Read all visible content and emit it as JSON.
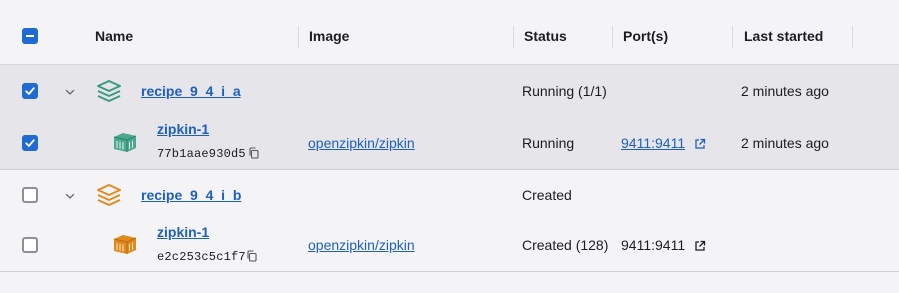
{
  "header": {
    "columns": {
      "name": "Name",
      "image": "Image",
      "status": "Status",
      "ports": "Port(s)",
      "last_started": "Last started"
    }
  },
  "groups": [
    {
      "name": "recipe_9_4_i_a",
      "status": "Running (1/1)",
      "last_started": "2 minutes ago",
      "selected": true,
      "icon": "stack-icon",
      "icon_color": "#3d9a82",
      "container": {
        "name": "zipkin-1",
        "id": "77b1aae930d5",
        "image": "openzipkin/zipkin",
        "status": "Running",
        "ports": "9411:9411",
        "last_started": "2 minutes ago",
        "selected": true,
        "icon": "container-icon",
        "icon_color": "#4aa88f"
      }
    },
    {
      "name": "recipe_9_4_i_b",
      "status": "Created",
      "last_started": "",
      "selected": false,
      "icon": "stack-icon",
      "icon_color": "#e08a1e",
      "container": {
        "name": "zipkin-1",
        "id": "e2c253c5c1f7",
        "image": "openzipkin/zipkin",
        "status": "Created (128)",
        "ports": "9411:9411",
        "last_started": "",
        "selected": false,
        "icon": "container-icon",
        "icon_color": "#e08a1e"
      }
    }
  ],
  "colors": {
    "accent": "#1f6bd1",
    "link": "#1f5fbf",
    "selected_row": "#e5e5ea",
    "background": "#f4f4f6"
  }
}
